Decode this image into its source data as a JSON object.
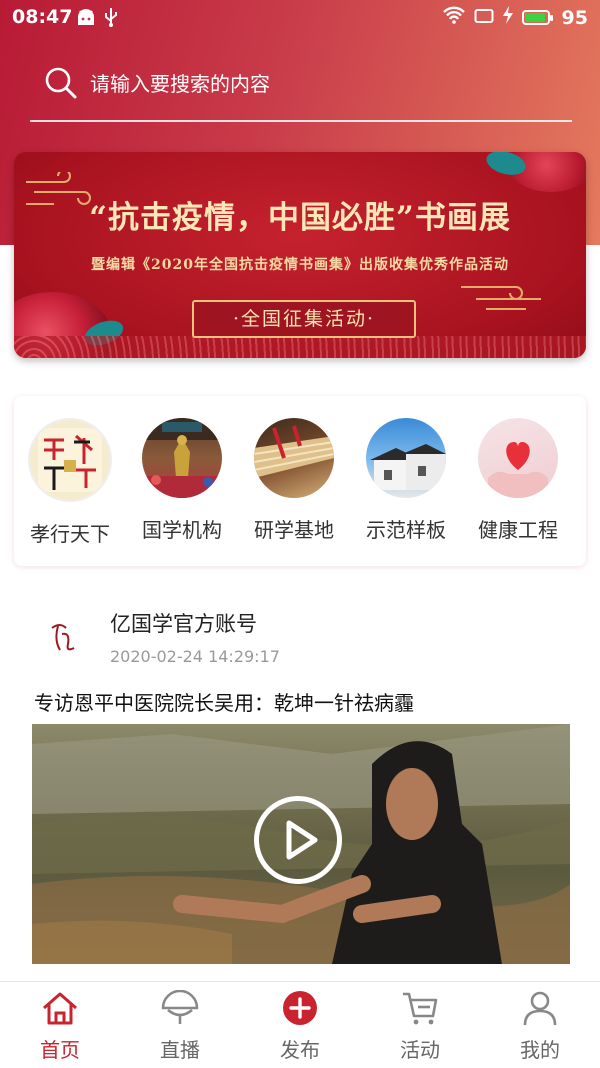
{
  "status_bar": {
    "time": "08:47",
    "battery_level": "95",
    "battery_fraction": 0.95,
    "icons": [
      "android-icon",
      "usb-icon",
      "wifi-icon",
      "screen-icon",
      "charging-icon",
      "battery-icon"
    ]
  },
  "search": {
    "placeholder": "请输入要搜索的内容",
    "value": ""
  },
  "banner": {
    "title": "“抗击疫情，中国必胜”书画展",
    "subtitle": "暨编辑《2020年全国抗击疫情书画集》出版收集优秀作品活动",
    "button_label": "·全国征集活动·"
  },
  "categories": [
    {
      "label": "孝行天下",
      "icon": "calligraphy-image"
    },
    {
      "label": "国学机构",
      "icon": "confucius-statue-image"
    },
    {
      "label": "研学基地",
      "icon": "study-base-image"
    },
    {
      "label": "示范样板",
      "icon": "village-houses-image"
    },
    {
      "label": "健康工程",
      "icon": "heart-hands-image"
    }
  ],
  "post": {
    "author": "亿国学官方账号",
    "timestamp": "2020-02-24 14:29:17",
    "title": "专访恩平中医院院长吴用：乾坤一针祛病霾"
  },
  "tabbar": {
    "items": [
      {
        "label": "首页",
        "icon": "home-icon",
        "active": true
      },
      {
        "label": "直播",
        "icon": "live-fan-icon",
        "active": false
      },
      {
        "label": "发布",
        "icon": "publish-plus-icon",
        "active": false
      },
      {
        "label": "活动",
        "icon": "cart-icon",
        "active": false
      },
      {
        "label": "我的",
        "icon": "user-icon",
        "active": false
      }
    ]
  },
  "colors": {
    "brand_red": "#c8232e",
    "header_gradient_start": "#b81a35",
    "header_gradient_end": "#e47a5e",
    "battery_green": "#3fd13f"
  }
}
